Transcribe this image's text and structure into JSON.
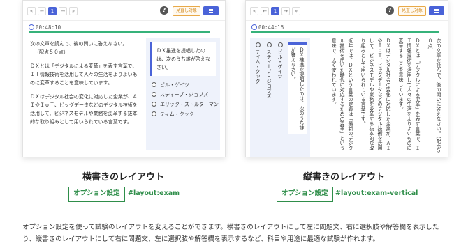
{
  "horizontal": {
    "nav": {
      "first": "«",
      "prev": "←",
      "page": "1",
      "next": "→",
      "last": "»"
    },
    "help": "?",
    "hold_button": "見直し対象",
    "timer": "00:48:10",
    "question_lines": [
      "次の文章を読んで、後の問いに答えなさい。",
      "（配点５０点）"
    ],
    "paragraph1": "ＤＸとは「デジタルによる変革」を表す言葉で、ＩＴ情報技術を活用して人々の生活をよりよいものに変革することを意味しています。",
    "paragraph2": "ＤＸはデジタル社会の変化に対応した企業が、ＡＩやＩｏＴ、ビッグデータなどのデジタル技術を活用して、ビジネスモデルや業務を変革する抜本的な取り組みとして用いられている言葉です。",
    "choice_prompt": "ＤＸ推進を提唱したのは、次のうち誰が答えなさい。",
    "options": [
      "ビル・ゲイツ",
      "スティーブ・ジョブズ",
      "エリック・ストルターマン",
      "ティム・クック"
    ]
  },
  "vertical": {
    "nav": {
      "first": "«",
      "prev": "←",
      "page": "1",
      "next": "→",
      "last": "»"
    },
    "help": "?",
    "hold_button": "見直し対象",
    "timer": "00:44:16",
    "question_text": "次の文章を読んで、後の問いに答えなさい。（配点５０点）",
    "paragraph1": "ＤＸとは「デジタルによる変革」を表す言葉で、ＩＴ情報技術を活用して人々の生活をよりよいものに変革することを意味しています。",
    "paragraph2": "ＤＸはデジタル社会の変化に対応した企業が、ＡＩやＩｏＴ、ビッグデータなどのデジタル技術を活用して、ビジネスモデルや業務を変革する抜本的な取り組みとして用いられている言葉です。",
    "paragraph3": "近年では、ＤＸという言葉の定義は「最新のデジタル技術を用いた時代に対応するための変革」という意味で、広く使われています。",
    "choice_prompt": "ＤＸ推進を提唱したのは、次のうち誰が答えなさい。",
    "options": [
      "ビル・ゲイツ",
      "スティーブ・ジョブズ",
      "ティム・クック"
    ]
  },
  "captions": {
    "horizontal_title": "横書きのレイアウト",
    "vertical_title": "縦書きのレイアウト",
    "option_badge": "オプション設定",
    "horizontal_tag": "#layout:exam",
    "vertical_tag": "#layout:exam-vertical"
  },
  "description": "オプション設定を使って試験のレイアウトを変えることができます。横書きのレイアウトにして左に問題文、右に選択肢や解答欄を表示したり、縦書きのレイアウトにして右に問題文、左に選択肢や解答欄を表示するなど、科目や用途に最適な試験が作れます。",
  "colors": {
    "accent": "#4a63d8",
    "green": "#2f8e4a",
    "progress": "#36b27a",
    "hold": "#e8a948"
  }
}
